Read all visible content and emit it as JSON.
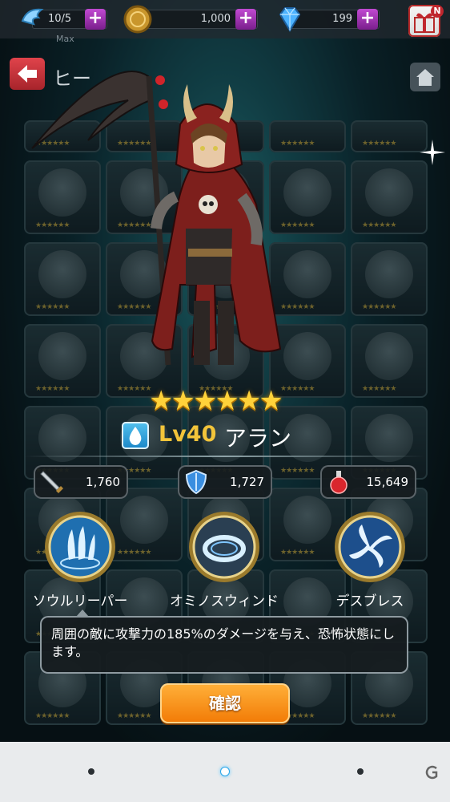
{
  "topbar": {
    "stamina": {
      "value": "10/5",
      "sub": "Max",
      "icon": "wing-icon"
    },
    "gold": {
      "value": "1,000",
      "icon": "coin-icon"
    },
    "gems": {
      "value": "199",
      "icon": "diamond-icon"
    },
    "plus_label": "+",
    "gift_badge": "N"
  },
  "nav": {
    "title": "ヒー"
  },
  "hero": {
    "stars": "★★★★★★",
    "rarity": 6,
    "element": "water",
    "level": "Lv40",
    "name": "アラン"
  },
  "stats": [
    {
      "icon": "sword-icon",
      "value": "1,760"
    },
    {
      "icon": "shield-icon",
      "value": "1,727"
    },
    {
      "icon": "potion-icon",
      "value": "15,649"
    }
  ],
  "skills": [
    {
      "name": "ソウルリーパー",
      "icon": "soul-reaper-icon"
    },
    {
      "name": "オミノスウィンド",
      "icon": "ominous-wind-icon"
    },
    {
      "name": "デスブレス",
      "icon": "death-breath-icon"
    }
  ],
  "skill_description": "周囲の敵に攻撃力の185%のダメージを与え、恐怖状態にします。",
  "confirm_label": "確認",
  "colors": {
    "accent_gold": "#f2c43a",
    "button_orange": "#f27a05",
    "water_blue": "#1a86c7"
  }
}
